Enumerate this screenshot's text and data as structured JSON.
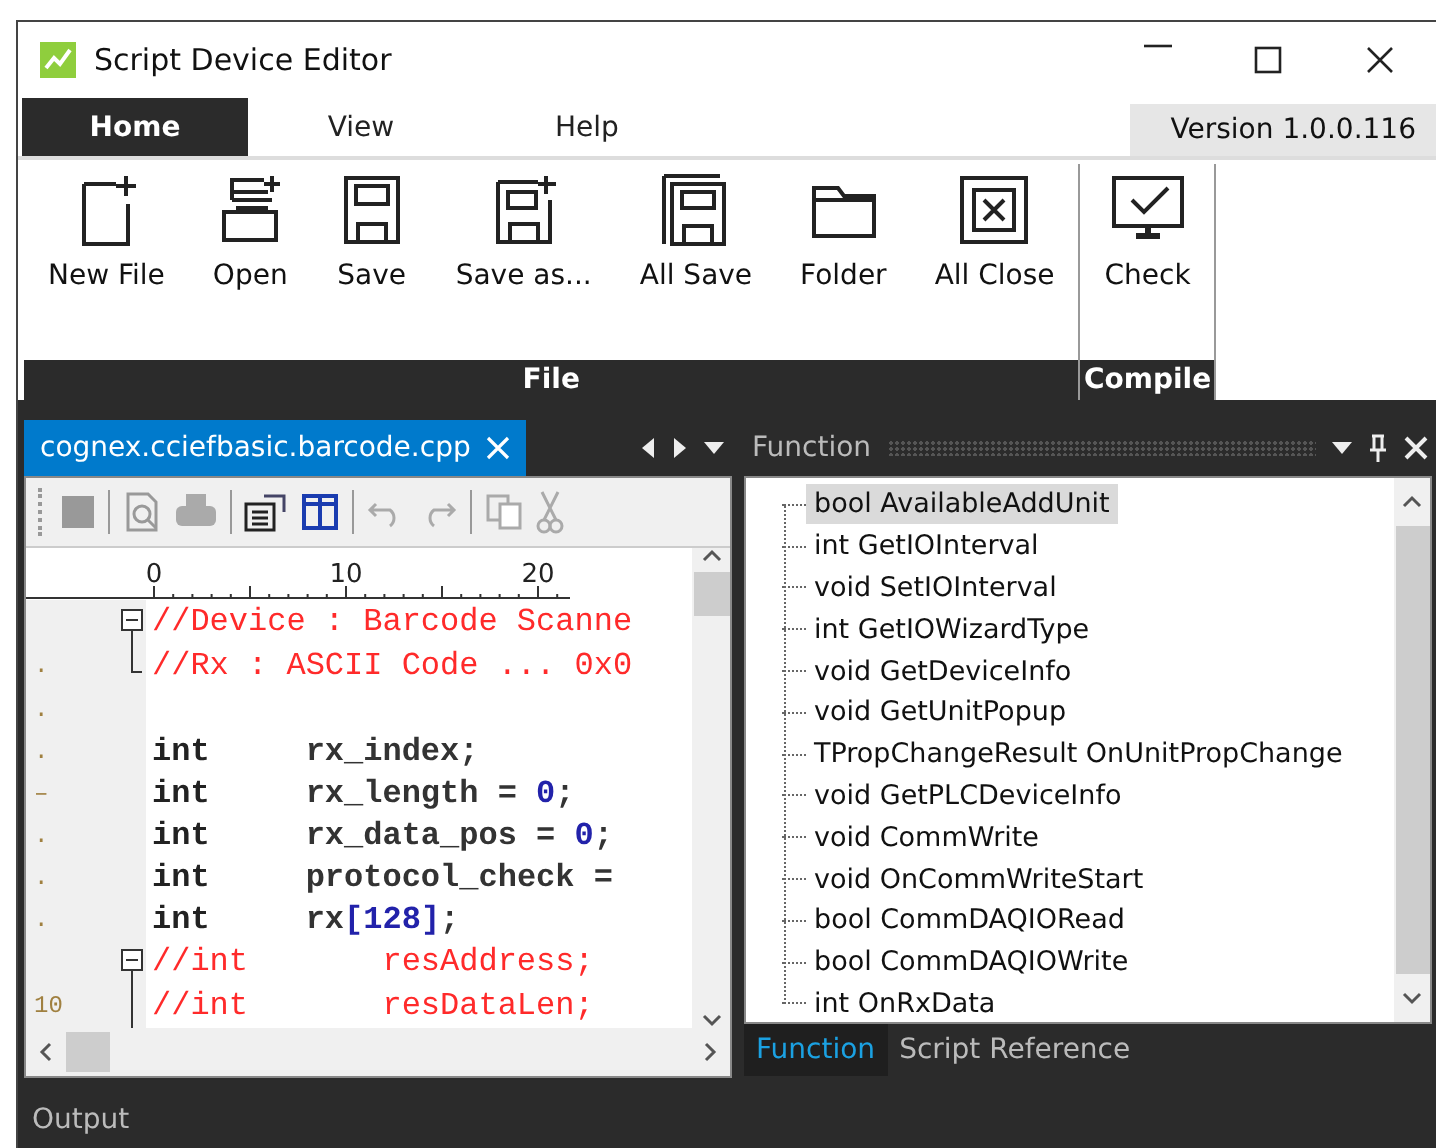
{
  "window": {
    "title": "Script Device Editor"
  },
  "menu": {
    "tabs": [
      {
        "label": "Home",
        "selected": true
      },
      {
        "label": "View",
        "selected": false
      },
      {
        "label": "Help",
        "selected": false
      }
    ],
    "version": "Version 1.0.0.116"
  },
  "ribbon": {
    "groups": [
      {
        "label": "File",
        "buttons": [
          {
            "label": "New File",
            "kind": "new"
          },
          {
            "label": "Open",
            "kind": "open"
          },
          {
            "label": "Save",
            "kind": "save"
          },
          {
            "label": "Save as...",
            "kind": "saveas"
          },
          {
            "label": "All Save",
            "kind": "allsave"
          },
          {
            "label": "Folder",
            "kind": "folder"
          },
          {
            "label": "All Close",
            "kind": "allclose"
          }
        ]
      },
      {
        "label": "Compile",
        "buttons": [
          {
            "label": "Check",
            "kind": "check"
          }
        ]
      }
    ]
  },
  "editor": {
    "tab": "cognex.cciefbasic.barcode.cpp",
    "ruler": [
      "0",
      "10",
      "20"
    ],
    "lines": [
      {
        "kind": "foldstart",
        "tokens": [
          {
            "kind": "comment",
            "text": "//Device : Barcode Scanne"
          }
        ]
      },
      {
        "gutter": ".",
        "kind": "foldend",
        "tokens": [
          {
            "kind": "comment",
            "text": "//Rx : ASCII Code ... 0x0"
          }
        ]
      },
      {
        "gutter": ".",
        "kind": "plain"
      },
      {
        "gutter": ".",
        "kind": "plain",
        "tokens": [
          {
            "kind": "keyword",
            "text": "int"
          },
          {
            "kind": "ident",
            "text": "     rx_index;"
          }
        ]
      },
      {
        "gutter": "–",
        "kind": "plain",
        "tokens": [
          {
            "kind": "keyword",
            "text": "int"
          },
          {
            "kind": "ident",
            "text": "     rx_length = "
          },
          {
            "kind": "number",
            "text": "0"
          },
          {
            "kind": "ident",
            "text": ";"
          }
        ]
      },
      {
        "gutter": ".",
        "kind": "plain",
        "tokens": [
          {
            "kind": "keyword",
            "text": "int"
          },
          {
            "kind": "ident",
            "text": "     rx_data_pos = "
          },
          {
            "kind": "number",
            "text": "0"
          },
          {
            "kind": "ident",
            "text": ";"
          }
        ]
      },
      {
        "gutter": ".",
        "kind": "plain",
        "tokens": [
          {
            "kind": "keyword",
            "text": "int"
          },
          {
            "kind": "ident",
            "text": "     protocol_check ="
          }
        ]
      },
      {
        "gutter": ".",
        "kind": "plain",
        "tokens": [
          {
            "kind": "keyword",
            "text": "int"
          },
          {
            "kind": "ident",
            "text": "     rx"
          },
          {
            "kind": "number",
            "text": "[128]"
          },
          {
            "kind": "ident",
            "text": ";"
          }
        ]
      },
      {
        "kind": "foldstart",
        "tokens": [
          {
            "kind": "comment",
            "text": "//int       resAddress;"
          }
        ]
      },
      {
        "gutter": "10",
        "kind": "foldbody",
        "tokens": [
          {
            "kind": "comment",
            "text": "//int       resDataLen;"
          }
        ]
      }
    ]
  },
  "function_panel": {
    "title": "Function",
    "items": [
      {
        "label": "bool AvailableAddUnit",
        "selected": true
      },
      {
        "label": "int GetIOInterval",
        "selected": false
      },
      {
        "label": "void SetIOInterval",
        "selected": false
      },
      {
        "label": "int GetIOWizardType",
        "selected": false
      },
      {
        "label": "void GetDeviceInfo",
        "selected": false
      },
      {
        "label": "void GetUnitPopup",
        "selected": false
      },
      {
        "label": "TPropChangeResult OnUnitPropChange",
        "selected": false
      },
      {
        "label": "void GetPLCDeviceInfo",
        "selected": false
      },
      {
        "label": "void CommWrite",
        "selected": false
      },
      {
        "label": "void OnCommWriteStart",
        "selected": false
      },
      {
        "label": "bool CommDAQIORead",
        "selected": false
      },
      {
        "label": "bool CommDAQIOWrite",
        "selected": false
      },
      {
        "label": "int OnRxData",
        "selected": false
      }
    ],
    "tabs": [
      {
        "label": "Function",
        "selected": true
      },
      {
        "label": "Script Reference",
        "selected": false
      }
    ]
  },
  "output": {
    "title": "Output"
  }
}
